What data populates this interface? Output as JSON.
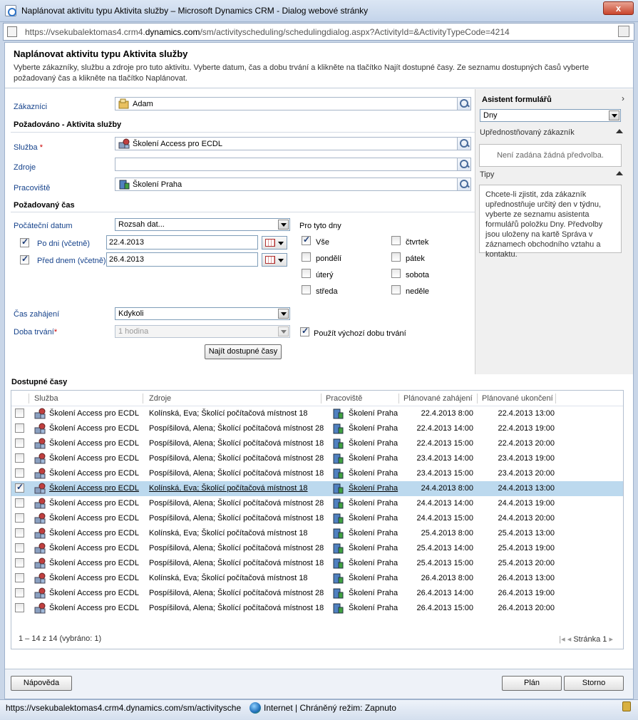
{
  "window": {
    "title": "Naplánovat aktivitu typu Aktivita služby – Microsoft Dynamics CRM - Dialog webové stránky",
    "close_label": "x"
  },
  "address": {
    "prefix": "https://vsekubalektomas4.crm4.",
    "domain": "dynamics.com",
    "path": "/sm/activityscheduling/schedulingdialog.aspx?ActivityId=&ActivityTypeCode=4214"
  },
  "header": {
    "title": "Naplánovat aktivitu typu Aktivita služby",
    "description": "Vyberte zákazníky, službu a zdroje pro tuto aktivitu. Vyberte datum, čas a dobu trvání a klikněte na tlačítko Najít dostupné časy. Ze seznamu dostupných časů vyberte požadovaný čas a klikněte na tlačítko Naplánovat."
  },
  "form": {
    "customers_label": "Zákazníci",
    "customers_value": "Adam",
    "requested_section": "Požadováno - Aktivita služby",
    "service_label": "Služba",
    "service_value": "Školení Access pro ECDL",
    "resources_label": "Zdroje",
    "resources_value": "",
    "site_label": "Pracoviště",
    "site_value": "Školení Praha",
    "time_section": "Požadovaný čas",
    "start_date_label": "Počáteční datum",
    "start_date_value": "Rozsah dat...",
    "after_label": "Po dni (včetně)",
    "after_value": "22.4.2013",
    "before_label": "Před dnem (včetně)",
    "before_value": "26.4.2013",
    "days_label": "Pro tyto dny",
    "days": {
      "all": "Vše",
      "mon": "pondělí",
      "tue": "úterý",
      "wed": "středa",
      "thu": "čtvrtek",
      "fri": "pátek",
      "sat": "sobota",
      "sun": "neděle"
    },
    "start_time_label": "Čas zahájení",
    "start_time_value": "Kdykoli",
    "duration_label": "Doba trvání",
    "duration_value": "1 hodina",
    "default_duration_label": "Použít výchozí dobu trvání",
    "find_button": "Najít dostupné časy",
    "required_mark": "*"
  },
  "assistant": {
    "title": "Asistent formulářů",
    "chevron": "›",
    "dropdown_value": "Dny",
    "preferred_label": "Upřednostňovaný zákazník",
    "preferred_empty": "Není zadána žádná předvolba.",
    "tips_label": "Tipy",
    "tips_text": "Chcete-li zjistit, zda zákazník upřednostňuje určitý den v týdnu, vyberte ze seznamu asistenta formulářů položku Dny. Předvolby jsou uloženy na kartě Správa v záznamech obchodního vztahu a kontaktu."
  },
  "results": {
    "title": "Dostupné časy",
    "columns": {
      "service": "Služba",
      "resources": "Zdroje",
      "site": "Pracoviště",
      "start": "Plánované zahájení",
      "end": "Plánované ukončení"
    },
    "rows": [
      {
        "service": "Školení Access pro ECDL",
        "resources": "Kolínská, Eva; Školící počítačová místnost 18",
        "site": "Školení Praha",
        "start": "22.4.2013 8:00",
        "end": "22.4.2013 13:00",
        "checked": false
      },
      {
        "service": "Školení Access pro ECDL",
        "resources": "Pospíšilová, Alena; Školící počítačová místnost 28",
        "site": "Školení Praha",
        "start": "22.4.2013 14:00",
        "end": "22.4.2013 19:00",
        "checked": false
      },
      {
        "service": "Školení Access pro ECDL",
        "resources": "Pospíšilová, Alena; Školící počítačová místnost 18",
        "site": "Školení Praha",
        "start": "22.4.2013 15:00",
        "end": "22.4.2013 20:00",
        "checked": false
      },
      {
        "service": "Školení Access pro ECDL",
        "resources": "Pospíšilová, Alena; Školící počítačová místnost 28",
        "site": "Školení Praha",
        "start": "23.4.2013 14:00",
        "end": "23.4.2013 19:00",
        "checked": false
      },
      {
        "service": "Školení Access pro ECDL",
        "resources": "Pospíšilová, Alena; Školící počítačová místnost 18",
        "site": "Školení Praha",
        "start": "23.4.2013 15:00",
        "end": "23.4.2013 20:00",
        "checked": false
      },
      {
        "service": "Školení Access pro ECDL",
        "resources": "Kolínská, Eva; Školící počítačová místnost 18",
        "site": "Školení Praha",
        "start": "24.4.2013 8:00",
        "end": "24.4.2013 13:00",
        "checked": true
      },
      {
        "service": "Školení Access pro ECDL",
        "resources": "Pospíšilová, Alena; Školící počítačová místnost 28",
        "site": "Školení Praha",
        "start": "24.4.2013 14:00",
        "end": "24.4.2013 19:00",
        "checked": false
      },
      {
        "service": "Školení Access pro ECDL",
        "resources": "Pospíšilová, Alena; Školící počítačová místnost 18",
        "site": "Školení Praha",
        "start": "24.4.2013 15:00",
        "end": "24.4.2013 20:00",
        "checked": false
      },
      {
        "service": "Školení Access pro ECDL",
        "resources": "Kolínská, Eva; Školící počítačová místnost 18",
        "site": "Školení Praha",
        "start": "25.4.2013 8:00",
        "end": "25.4.2013 13:00",
        "checked": false
      },
      {
        "service": "Školení Access pro ECDL",
        "resources": "Pospíšilová, Alena; Školící počítačová místnost 28",
        "site": "Školení Praha",
        "start": "25.4.2013 14:00",
        "end": "25.4.2013 19:00",
        "checked": false
      },
      {
        "service": "Školení Access pro ECDL",
        "resources": "Pospíšilová, Alena; Školící počítačová místnost 18",
        "site": "Školení Praha",
        "start": "25.4.2013 15:00",
        "end": "25.4.2013 20:00",
        "checked": false
      },
      {
        "service": "Školení Access pro ECDL",
        "resources": "Kolínská, Eva; Školící počítačová místnost 18",
        "site": "Školení Praha",
        "start": "26.4.2013 8:00",
        "end": "26.4.2013 13:00",
        "checked": false
      },
      {
        "service": "Školení Access pro ECDL",
        "resources": "Pospíšilová, Alena; Školící počítačová místnost 28",
        "site": "Školení Praha",
        "start": "26.4.2013 14:00",
        "end": "26.4.2013 19:00",
        "checked": false
      },
      {
        "service": "Školení Access pro ECDL",
        "resources": "Pospíšilová, Alena; Školící počítačová místnost 18",
        "site": "Školení Praha",
        "start": "26.4.2013 15:00",
        "end": "26.4.2013 20:00",
        "checked": false
      }
    ],
    "count_text": "1 – 14  z 14 (vybráno: 1)",
    "pager_text": "Stránka 1"
  },
  "footer": {
    "help_button": "Nápověda",
    "plan_button": "Plán",
    "cancel_button": "Storno"
  },
  "status": {
    "url": "https://vsekubalektomas4.crm4.dynamics.com/sm/activitysche",
    "zone": "Internet | Chráněný režim: Zapnuto"
  },
  "colors": {
    "accent": "#15428b",
    "selected_row": "#bcd9ee",
    "required": "#cc0000"
  }
}
